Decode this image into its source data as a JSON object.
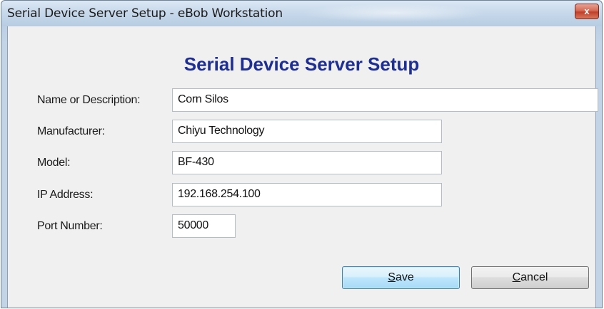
{
  "window": {
    "title": "Serial Device Server Setup - eBob Workstation",
    "close_glyph": "x"
  },
  "form": {
    "heading": "Serial Device Server Setup",
    "fields": [
      {
        "label": "Name or Description:",
        "value": "Corn Silos"
      },
      {
        "label": "Manufacturer:",
        "value": "Chiyu Technology"
      },
      {
        "label": "Model:",
        "value": "BF-430"
      },
      {
        "label": "IP Address:",
        "value": "192.168.254.100"
      },
      {
        "label": "Port Number:",
        "value": "50000"
      }
    ]
  },
  "buttons": {
    "save": {
      "mnemonic": "S",
      "rest": "ave"
    },
    "cancel": {
      "mnemonic": "C",
      "rest": "ancel"
    }
  },
  "colors": {
    "heading": "#1f2f8f",
    "titlebar": "#c8d9eb",
    "save_border": "#3c7fb1",
    "close_button": "#c0402a"
  },
  "icons": [
    "close-icon"
  ]
}
